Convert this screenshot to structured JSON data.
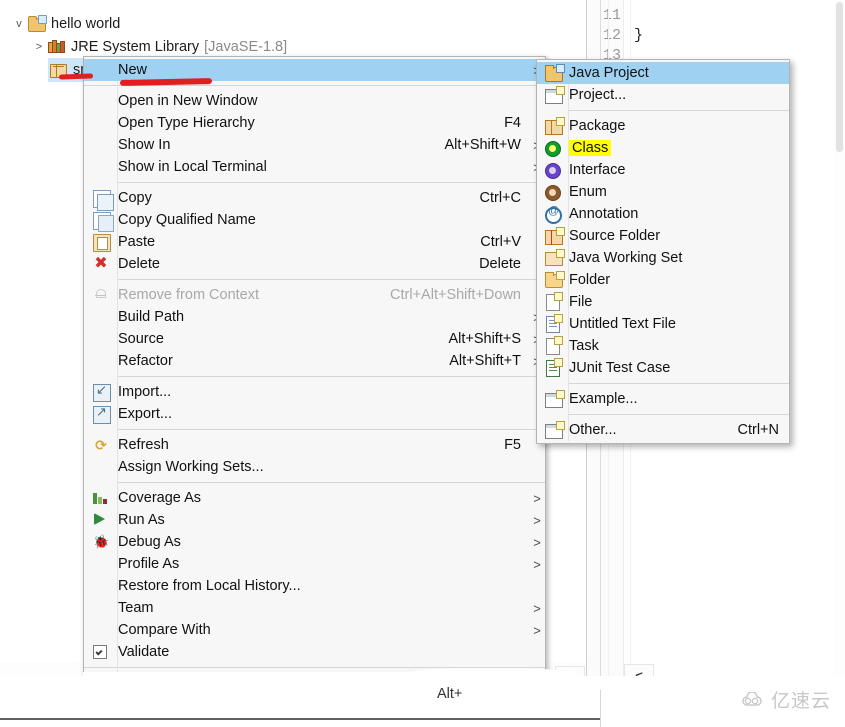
{
  "tree": {
    "items": [
      {
        "label": "hello world",
        "twisty": "v",
        "icon": "project-icon",
        "indent": 16,
        "dim": ""
      },
      {
        "label": "JRE System Library",
        "twisty": ">",
        "icon": "jre-library-icon",
        "indent": 36,
        "dim": "[JavaSE-1.8]"
      },
      {
        "label": "sr",
        "twisty": "",
        "icon": "source-package-icon",
        "indent": 50,
        "dim": ""
      }
    ]
  },
  "editor": {
    "lines": [
      {
        "num": "11",
        "text": ""
      },
      {
        "num": "12",
        "text": "}"
      },
      {
        "num": "13",
        "text": ""
      }
    ]
  },
  "explorer_bottom": {
    "left_scroll_label": ">",
    "right_scroll_label": "<"
  },
  "context_menu": {
    "items": [
      {
        "label": "New",
        "accel": "",
        "arrow": ">",
        "icon": "",
        "state": "selected"
      },
      {
        "type": "separator"
      },
      {
        "label": "Open in New Window",
        "accel": "",
        "arrow": "",
        "icon": "",
        "state": "normal"
      },
      {
        "label": "Open Type Hierarchy",
        "accel": "F4",
        "arrow": "",
        "icon": "",
        "state": "normal"
      },
      {
        "label": "Show In",
        "accel": "Alt+Shift+W",
        "arrow": ">",
        "icon": "",
        "state": "normal"
      },
      {
        "label": "Show in Local Terminal",
        "accel": "",
        "arrow": ">",
        "icon": "",
        "state": "normal"
      },
      {
        "type": "separator"
      },
      {
        "label": "Copy",
        "accel": "Ctrl+C",
        "arrow": "",
        "icon": "copy-icon",
        "state": "normal"
      },
      {
        "label": "Copy Qualified Name",
        "accel": "",
        "arrow": "",
        "icon": "copy-qualified-name-icon",
        "state": "normal"
      },
      {
        "label": "Paste",
        "accel": "Ctrl+V",
        "arrow": "",
        "icon": "paste-icon",
        "state": "normal"
      },
      {
        "label": "Delete",
        "accel": "Delete",
        "arrow": "",
        "icon": "delete-icon",
        "state": "normal"
      },
      {
        "type": "separator"
      },
      {
        "label": "Remove from Context",
        "accel": "Ctrl+Alt+Shift+Down",
        "arrow": "",
        "icon": "remove-from-context-icon",
        "state": "disabled"
      },
      {
        "label": "Build Path",
        "accel": "",
        "arrow": ">",
        "icon": "",
        "state": "normal"
      },
      {
        "label": "Source",
        "accel": "Alt+Shift+S",
        "arrow": ">",
        "icon": "",
        "state": "normal"
      },
      {
        "label": "Refactor",
        "accel": "Alt+Shift+T",
        "arrow": ">",
        "icon": "",
        "state": "normal"
      },
      {
        "type": "separator"
      },
      {
        "label": "Import...",
        "accel": "",
        "arrow": "",
        "icon": "import-icon",
        "state": "normal"
      },
      {
        "label": "Export...",
        "accel": "",
        "arrow": "",
        "icon": "export-icon",
        "state": "normal"
      },
      {
        "type": "separator"
      },
      {
        "label": "Refresh",
        "accel": "F5",
        "arrow": "",
        "icon": "refresh-icon",
        "state": "normal"
      },
      {
        "label": "Assign Working Sets...",
        "accel": "",
        "arrow": "",
        "icon": "",
        "state": "normal"
      },
      {
        "type": "separator"
      },
      {
        "label": "Coverage As",
        "accel": "",
        "arrow": ">",
        "icon": "coverage-icon",
        "state": "normal"
      },
      {
        "label": "Run As",
        "accel": "",
        "arrow": ">",
        "icon": "run-icon",
        "state": "normal"
      },
      {
        "label": "Debug As",
        "accel": "",
        "arrow": ">",
        "icon": "debug-icon",
        "state": "normal"
      },
      {
        "label": "Profile As",
        "accel": "",
        "arrow": ">",
        "icon": "",
        "state": "normal"
      },
      {
        "label": "Restore from Local History...",
        "accel": "",
        "arrow": "",
        "icon": "",
        "state": "normal"
      },
      {
        "label": "Team",
        "accel": "",
        "arrow": ">",
        "icon": "",
        "state": "normal"
      },
      {
        "label": "Compare With",
        "accel": "",
        "arrow": ">",
        "icon": "",
        "state": "normal"
      },
      {
        "label": "Validate",
        "accel": "",
        "arrow": "",
        "icon": "checkbox-checked-icon",
        "state": "normal"
      }
    ],
    "cutoff_accel": "Alt+"
  },
  "submenu": {
    "items": [
      {
        "label": "Java Project",
        "accel": "",
        "icon": "java-project-icon",
        "state": "selected"
      },
      {
        "label": "Project...",
        "accel": "",
        "icon": "project-icon",
        "state": "normal"
      },
      {
        "type": "separator"
      },
      {
        "label": "Package",
        "accel": "",
        "icon": "package-icon",
        "state": "normal"
      },
      {
        "label": "Class",
        "accel": "",
        "icon": "class-icon",
        "state": "highlighted"
      },
      {
        "label": "Interface",
        "accel": "",
        "icon": "interface-icon",
        "state": "normal"
      },
      {
        "label": "Enum",
        "accel": "",
        "icon": "enum-icon",
        "state": "normal"
      },
      {
        "label": "Annotation",
        "accel": "",
        "icon": "annotation-icon",
        "state": "normal"
      },
      {
        "label": "Source Folder",
        "accel": "",
        "icon": "source-folder-icon",
        "state": "normal"
      },
      {
        "label": "Java Working Set",
        "accel": "",
        "icon": "java-working-set-icon",
        "state": "normal"
      },
      {
        "label": "Folder",
        "accel": "",
        "icon": "folder-icon",
        "state": "normal"
      },
      {
        "label": "File",
        "accel": "",
        "icon": "file-icon",
        "state": "normal"
      },
      {
        "label": "Untitled Text File",
        "accel": "",
        "icon": "text-file-icon",
        "state": "normal"
      },
      {
        "label": "Task",
        "accel": "",
        "icon": "task-icon",
        "state": "normal"
      },
      {
        "label": "JUnit Test Case",
        "accel": "",
        "icon": "junit-icon",
        "state": "normal"
      },
      {
        "type": "separator"
      },
      {
        "label": "Example...",
        "accel": "",
        "icon": "example-icon",
        "state": "normal"
      },
      {
        "type": "separator"
      },
      {
        "label": "Other...",
        "accel": "Ctrl+N",
        "icon": "other-icon",
        "state": "normal"
      }
    ]
  },
  "annotations": {
    "underline_color": "#e02020",
    "highlight_color": "#ffff00",
    "selection_color": "#9fd2f2"
  },
  "watermark": {
    "text": "亿速云"
  }
}
